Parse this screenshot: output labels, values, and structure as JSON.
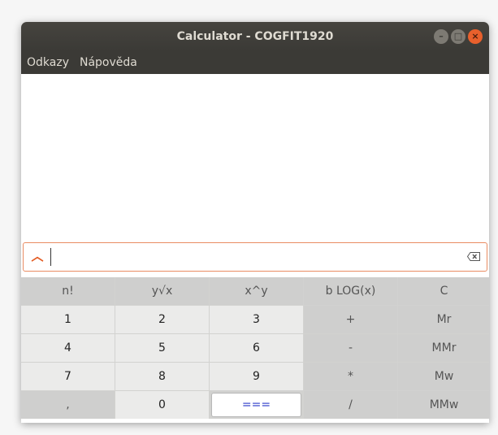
{
  "window": {
    "title": "Calculator - COGFIT1920"
  },
  "menu": {
    "items": [
      "Odkazy",
      "Nápověda"
    ]
  },
  "input": {
    "value": ""
  },
  "keys": {
    "row1": [
      "n!",
      "y√x",
      "x^y",
      "b LOG(x)",
      "C"
    ],
    "row2": [
      "1",
      "2",
      "3",
      "+",
      "Mr"
    ],
    "row3": [
      "4",
      "5",
      "6",
      "-",
      "MMr"
    ],
    "row4": [
      "7",
      "8",
      "9",
      "*",
      "Mw"
    ],
    "row5": [
      ",",
      "0",
      "===",
      "/",
      "MMw"
    ]
  },
  "colors": {
    "accent": "#e35a22",
    "equals_text": "#2a37c8",
    "titlebar": "#3b3a36"
  }
}
